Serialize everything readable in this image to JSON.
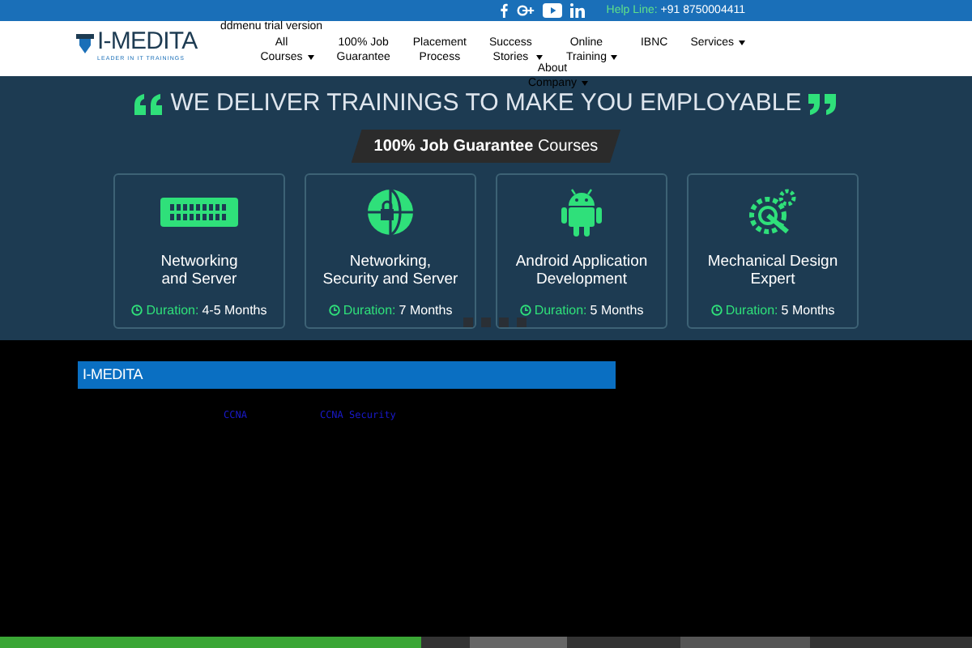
{
  "top_bar": {
    "social": [
      {
        "kind": "facebook"
      },
      {
        "kind": "googleplus"
      },
      {
        "kind": "youtube"
      },
      {
        "kind": "linkedin"
      }
    ],
    "helpline_label": "Help Line:",
    "helpline_number": "+91 8750004411"
  },
  "header": {
    "logo": {
      "name": "I-MEDITA",
      "tagline": "LEADER IN IT TRAININGS"
    },
    "notice": "ddmenu trial version",
    "menu": [
      {
        "label": "All\nCourses",
        "dropdown": true
      },
      {
        "label": "100% Job\nGuarantee",
        "dropdown": false
      },
      {
        "label": "Placement\nProcess",
        "dropdown": false
      },
      {
        "label": "Success\nStories",
        "dropdown": true
      },
      {
        "label": "Online\nTraining",
        "dropdown": true
      },
      {
        "label": "IBNC",
        "dropdown": false
      },
      {
        "label": "Services",
        "dropdown": true
      },
      {
        "label": "About\nCompany",
        "dropdown": true
      }
    ]
  },
  "banner": {
    "headline": "WE DELIVER TRAININGS TO MAKE YOU EMPLOYABLE",
    "badge": "**100% Job Guarantee** Courses",
    "courses": [
      {
        "kind": "network",
        "title": "Networking\nand Server",
        "duration_label": "Duration:",
        "duration": "4-5 Months"
      },
      {
        "kind": "security",
        "title": "Networking,\nSecurity and Server",
        "duration_label": "Duration:",
        "duration": "7 Months"
      },
      {
        "kind": "android",
        "title": "Android Application\nDevelopment",
        "duration_label": "Duration:",
        "duration": "5 Months"
      },
      {
        "kind": "mechanical",
        "title": "Mechanical Design\nExpert",
        "duration_label": "Duration:",
        "duration": "5 Months"
      }
    ]
  },
  "section": {
    "logo": "I-MEDITA",
    "links": [
      "CCNA",
      "CCNA Security"
    ]
  }
}
